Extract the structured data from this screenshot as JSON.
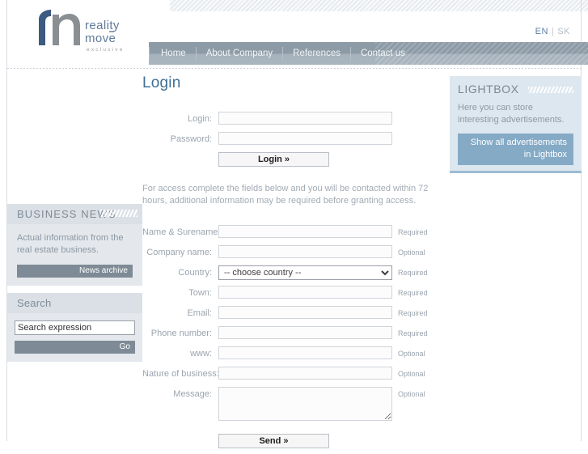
{
  "site": {
    "logo_primary": "reality",
    "logo_secondary": "move",
    "logo_tagline": "exclusive",
    "brand_blue": "#3d5a80",
    "brand_gray": "#8a8f94"
  },
  "language": {
    "active": "EN",
    "separator": "|",
    "inactive": "SK"
  },
  "nav": {
    "items": [
      {
        "label": "Home"
      },
      {
        "label": "About Company"
      },
      {
        "label": "References"
      },
      {
        "label": "Contact us"
      }
    ]
  },
  "main": {
    "title": "Login",
    "login_form": {
      "login_label": "Login:",
      "login_value": "",
      "password_label": "Password:",
      "password_value": "",
      "submit_label": "Login »"
    },
    "intro": "For access complete the fields below and you will be contacted within 72 hours, additional information may be required before granting access.",
    "access_form": {
      "fields": [
        {
          "label": "Name & Surename:",
          "value": "",
          "requirement": "Required",
          "type": "text"
        },
        {
          "label": "Company name:",
          "value": "",
          "requirement": "Optional",
          "type": "text"
        },
        {
          "label": "Country:",
          "value": "-- choose country --",
          "requirement": "Required",
          "type": "select"
        },
        {
          "label": "Town:",
          "value": "",
          "requirement": "Required",
          "type": "text"
        },
        {
          "label": "Email:",
          "value": "",
          "requirement": "Required",
          "type": "text"
        },
        {
          "label": "Phone number:",
          "value": "",
          "requirement": "Required",
          "type": "text"
        },
        {
          "label": "www:",
          "value": "",
          "requirement": "Optional",
          "type": "text"
        },
        {
          "label": "Nature of business:",
          "value": "",
          "requirement": "Optional",
          "type": "text"
        },
        {
          "label": "Message:",
          "value": "",
          "requirement": "Optional",
          "type": "textarea"
        }
      ],
      "submit_label": "Send »"
    }
  },
  "left_sidebar": {
    "news": {
      "title": "BUSINESS NEWS",
      "text": "Actual information from the real estate business.",
      "archive_label": "News archive"
    },
    "search": {
      "title": "Search",
      "value": "Search expression",
      "go_label": "Go"
    }
  },
  "right_sidebar": {
    "lightbox": {
      "title": "LIGHTBOX",
      "text": "Here you can store interesting advertisements.",
      "button_label": "Show all advertisements in Lightbox"
    }
  }
}
